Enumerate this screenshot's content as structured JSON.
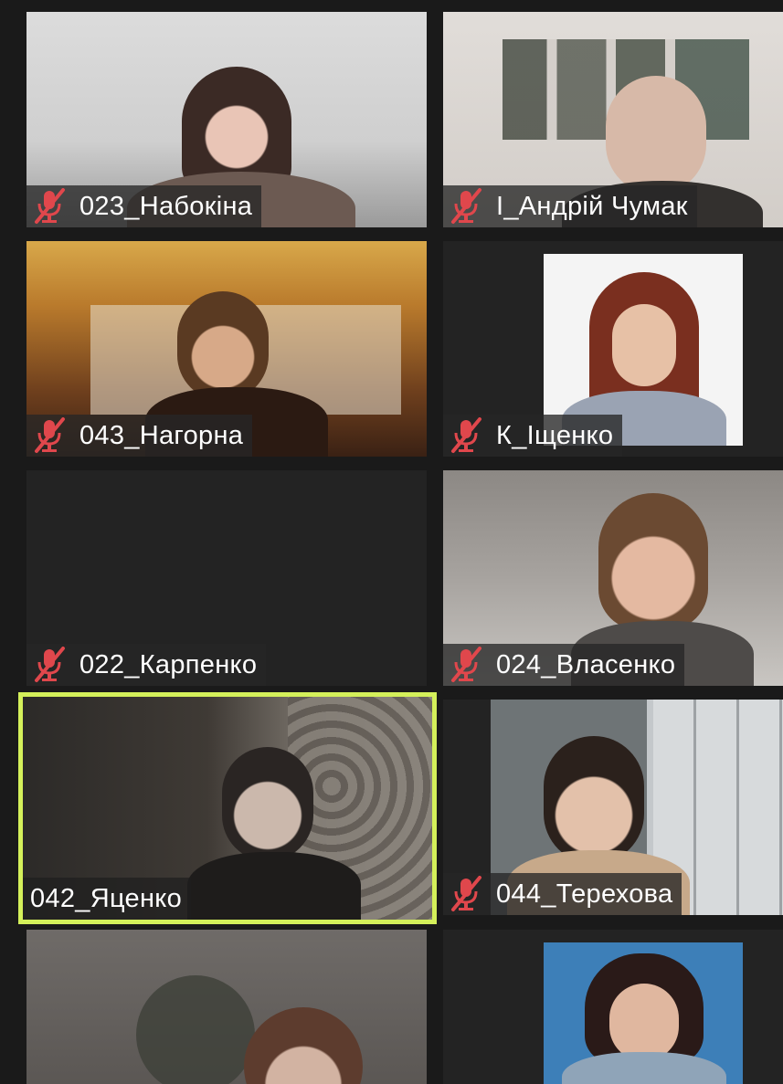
{
  "participants": [
    {
      "name": "023_Набокіна",
      "muted": true,
      "active": false
    },
    {
      "name": "І_Андрій Чумак",
      "muted": true,
      "active": false
    },
    {
      "name": "043_Нагорна",
      "muted": true,
      "active": false
    },
    {
      "name": "К_Іщенко",
      "muted": true,
      "active": false
    },
    {
      "name": "022_Карпенко",
      "muted": true,
      "active": false
    },
    {
      "name": "024_Власенко",
      "muted": true,
      "active": false
    },
    {
      "name": "042_Яценко",
      "muted": false,
      "active": true
    },
    {
      "name": "044_Терехова",
      "muted": true,
      "active": false
    },
    {
      "name": "",
      "muted": false,
      "active": false
    },
    {
      "name": "",
      "muted": false,
      "active": false
    }
  ],
  "icons": {
    "muted": "muted-microphone-icon"
  },
  "colors": {
    "active_border": "#d4f05a",
    "mute_icon": "#e0474c",
    "background": "#1a1a1a"
  }
}
